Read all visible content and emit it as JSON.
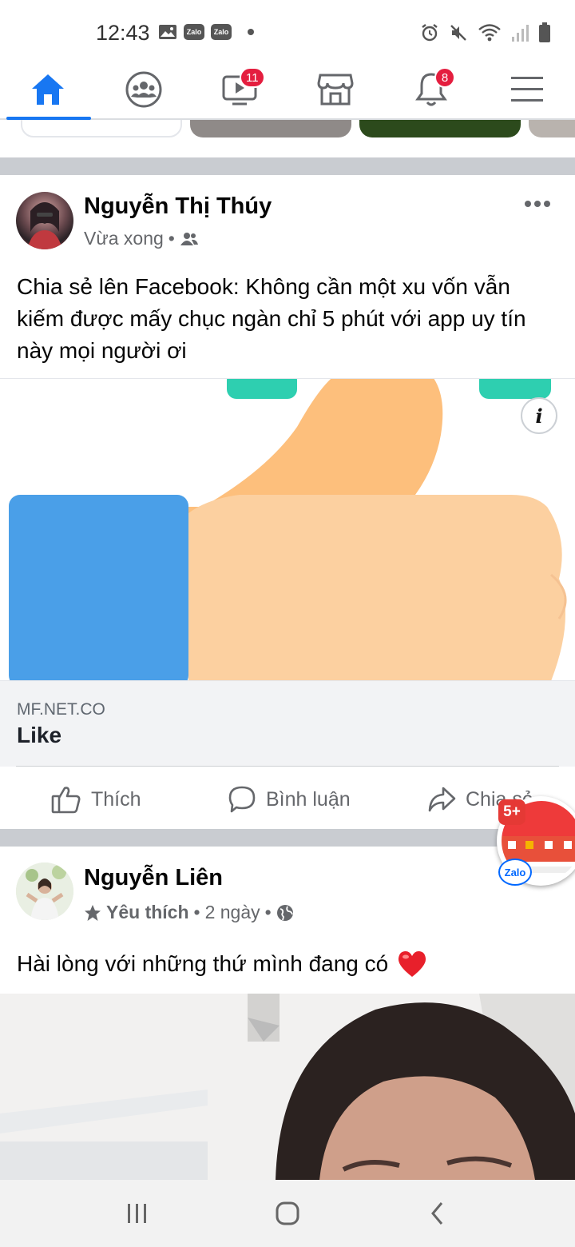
{
  "status_bar": {
    "time": "12:43",
    "left_icons": [
      "gallery-icon",
      "zalo-icon",
      "zalo-icon",
      "dot-icon"
    ],
    "zalo_label": "Zalo",
    "right_icons": [
      "alarm-icon",
      "mute-icon",
      "wifi-icon",
      "signal-icon",
      "battery-icon"
    ]
  },
  "nav": {
    "items": [
      {
        "name": "home",
        "icon": "home-icon",
        "active": true
      },
      {
        "name": "groups",
        "icon": "groups-icon"
      },
      {
        "name": "watch",
        "icon": "video-icon",
        "badge": "11"
      },
      {
        "name": "marketplace",
        "icon": "shop-icon"
      },
      {
        "name": "notifications",
        "icon": "bell-icon",
        "badge": "8"
      },
      {
        "name": "menu",
        "icon": "menu-icon"
      }
    ],
    "accent": "#1877f2",
    "badge_color": "#e41e3f"
  },
  "post1": {
    "author": "Nguyễn Thị Thúy",
    "time": "Vừa xong",
    "audience_icon": "friends-icon",
    "text": "Chia sẻ lên Facebook: Không cần một xu vốn vẫn kiếm được mấy chục ngàn chỉ 5 phút với app uy tín này mọi người ơi",
    "link": {
      "domain": "MF.NET.CO",
      "title": "Like",
      "info_label": "i"
    }
  },
  "actions": {
    "like": "Thích",
    "comment": "Bình luận",
    "share": "Chia sẻ"
  },
  "chathead": {
    "badge": "5+",
    "app": "Zalo"
  },
  "post2": {
    "author": "Nguyễn Liên",
    "favorite": "Yêu thích",
    "time": "2 ngày",
    "audience_icon": "globe-icon",
    "text": "Hài lòng với những thứ mình đang có",
    "emoji": "❤️"
  },
  "system_nav": [
    "recents-icon",
    "home-circle-icon",
    "back-icon"
  ]
}
